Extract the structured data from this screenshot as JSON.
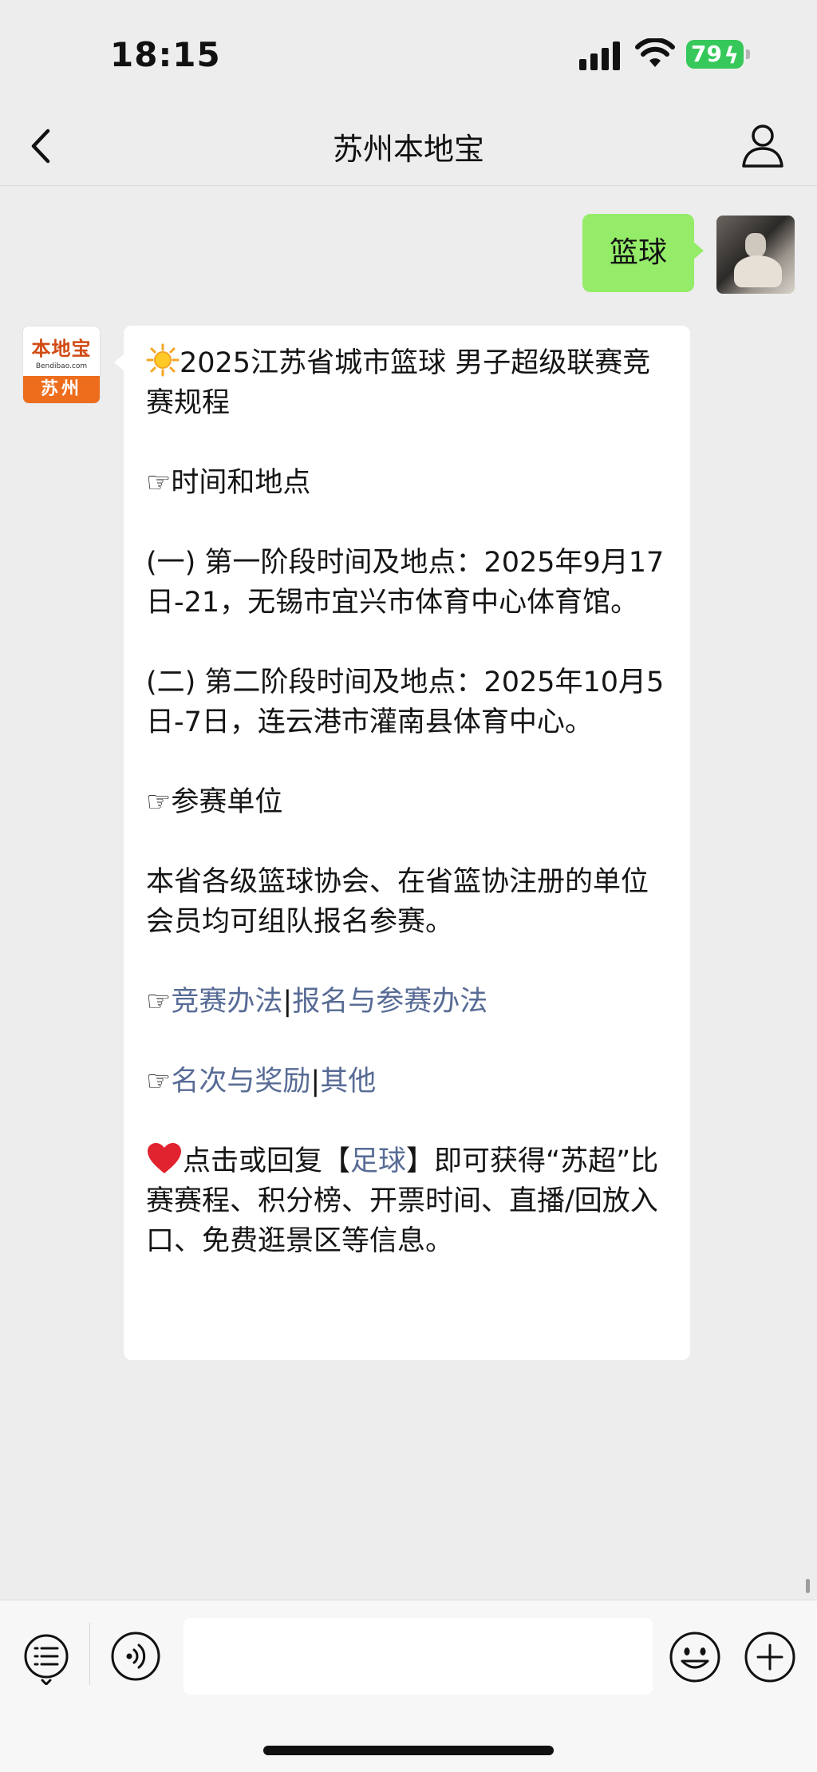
{
  "status_bar": {
    "time": "18:15",
    "battery": "79",
    "icons": [
      "signal-icon",
      "wifi-icon",
      "battery-charging-icon"
    ]
  },
  "nav": {
    "title": "苏州本地宝",
    "icons": [
      "back-chevron-icon",
      "person-icon"
    ]
  },
  "messages": {
    "user_message": "篮球",
    "bot_avatar": {
      "logo_text": "本地宝",
      "site_text": "Bendibao.com",
      "city_text": "苏州"
    },
    "bot_reply": {
      "headline": "2025江苏省城市篮球 男子超级联赛竞赛规程",
      "section1_title": "时间和地点",
      "stage1": "(一) 第一阶段时间及地点：2025年9月17日-21，无锡市宜兴市体育中心体育馆。",
      "stage2": "(二) 第二阶段时间及地点：2025年10月5日-7日，连云港市灌南县体育中心。",
      "section2_title": "参赛单位",
      "participants": "本省各级篮球协会、在省篮协注册的单位会员均可组队报名参赛。",
      "link1": "竞赛办法",
      "link2": "报名与参赛办法",
      "link3": "名次与奖励",
      "link4": "其他",
      "separator": "|",
      "pointer": "☞",
      "footer_part1": "点击或回复【",
      "footer_link": "足球",
      "footer_part2": "】即可获得“苏超”比赛赛程、积分榜、开票时间、直播/回放入口、免费逛景区等信息。"
    }
  },
  "input_bar": {
    "value": "",
    "icons": [
      "menu-list-icon",
      "voice-icon",
      "emoji-icon",
      "plus-icon"
    ]
  },
  "colors": {
    "bubble_me": "#95ec69",
    "link": "#576b95",
    "background": "#ededed",
    "battery": "#36c85a"
  }
}
